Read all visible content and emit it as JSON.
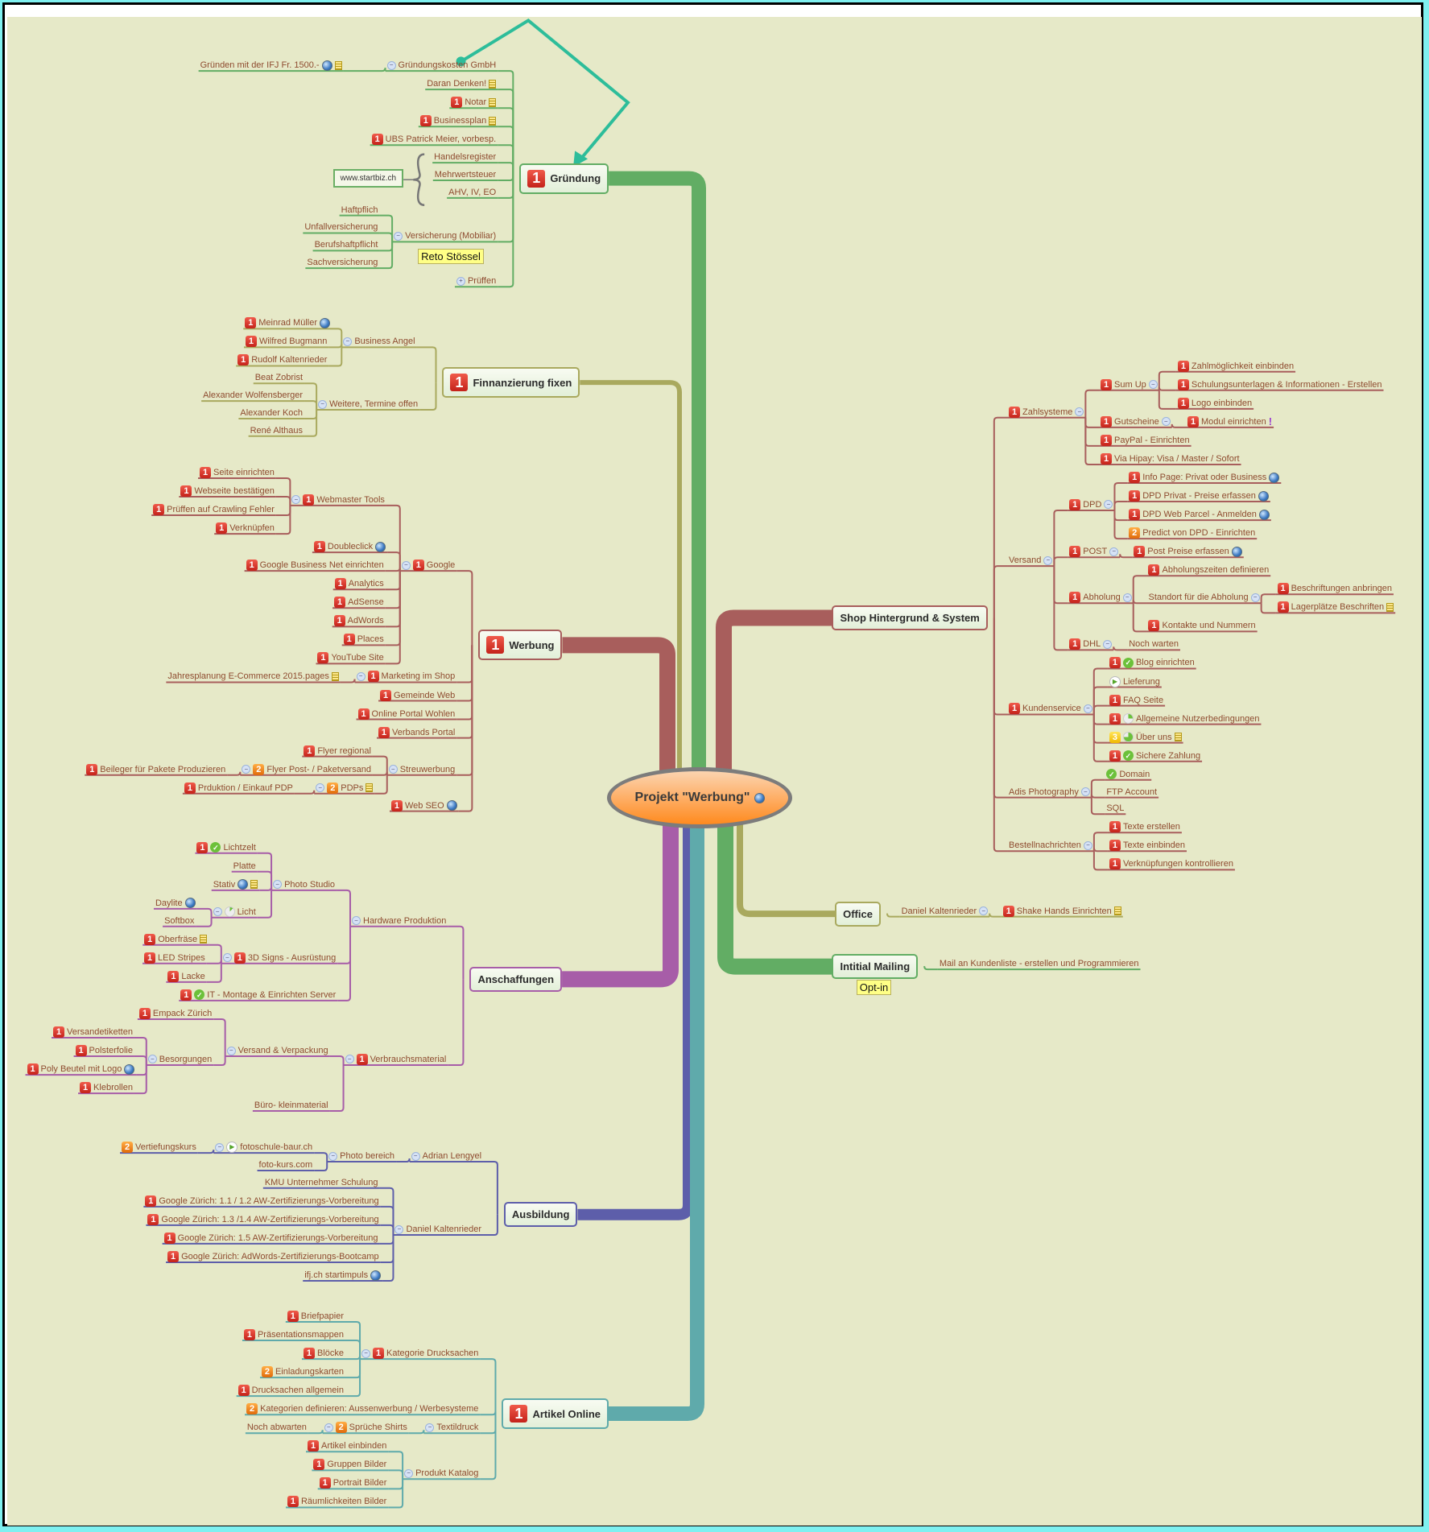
{
  "central": {
    "label": "Projekt \"Werbung\"",
    "icon": "globe-icon"
  },
  "colors": {
    "background": "#e6e9c8",
    "gruendung": "#62ad64",
    "finanzierung": "#a9a95e",
    "werbung": "#a85e5c",
    "shop": "#a85e5c",
    "anschaffungen": "#a75da8",
    "ausbildung": "#5d5eaa",
    "artikel": "#5faaab",
    "office": "#a9a95e",
    "mailing": "#62ad64",
    "relationship": "#2dbd9a"
  },
  "topics": [
    {
      "id": "gruendung",
      "label": "Gründung",
      "priority": 1
    },
    {
      "id": "finanzierung",
      "label": "Finnanzierung fixen",
      "priority": 1
    },
    {
      "id": "werbung",
      "label": "Werbung",
      "priority": 1
    },
    {
      "id": "anschaffungen",
      "label": "Anschaffungen",
      "priority": null
    },
    {
      "id": "ausbildung",
      "label": "Ausbildung",
      "priority": null
    },
    {
      "id": "artikel",
      "label": "Artikel Online",
      "priority": 1
    },
    {
      "id": "shop",
      "label": "Shop Hintergrund & System",
      "priority": null
    },
    {
      "id": "office",
      "label": "Office",
      "priority": null
    },
    {
      "id": "mailing",
      "label": "Intitial Mailing",
      "priority": null
    }
  ],
  "callouts": {
    "gruendung_versicherung": "Reto Stössel",
    "mailing": "Opt-in"
  },
  "boundary": {
    "label": "www.startbiz.ch"
  },
  "nodes": [
    {
      "id": "g1",
      "label": "Gründungskosten GmbH",
      "collapse": true
    },
    {
      "id": "g1a",
      "label": "Gründen mit der IFJ Fr. 1500.-",
      "icons": [
        "globe",
        "note"
      ]
    },
    {
      "id": "g2",
      "label": "Daran Denken!",
      "icons": [
        "note"
      ]
    },
    {
      "id": "g3",
      "label": "Notar",
      "priority": 1,
      "icons": [
        "note"
      ]
    },
    {
      "id": "g4",
      "label": "Businessplan",
      "priority": 1,
      "icons": [
        "note"
      ]
    },
    {
      "id": "g5",
      "label": "UBS Patrick Meier, vorbesp.",
      "priority": 1
    },
    {
      "id": "g6",
      "label": "Handelsregister"
    },
    {
      "id": "g7",
      "label": "Mehrwertsteuer"
    },
    {
      "id": "g8",
      "label": "AHV, IV, EO"
    },
    {
      "id": "g9",
      "label": "Versicherung (Mobiliar)",
      "collapse": true
    },
    {
      "id": "g9a",
      "label": "Haftpflich"
    },
    {
      "id": "g9b",
      "label": "Unfallversicherung"
    },
    {
      "id": "g9c",
      "label": "Berufshaftpflicht"
    },
    {
      "id": "g9d",
      "label": "Sachversicherung"
    },
    {
      "id": "g10",
      "label": "Prüffen",
      "expand": true
    },
    {
      "id": "f1",
      "label": "Business Angel",
      "collapse": true
    },
    {
      "id": "f1a",
      "label": "Meinrad Müller",
      "priority": 1,
      "icons": [
        "globe"
      ]
    },
    {
      "id": "f1b",
      "label": "Wilfred Bugmann",
      "priority": 1
    },
    {
      "id": "f1c",
      "label": "Rudolf Kaltenrieder",
      "priority": 1
    },
    {
      "id": "f2",
      "label": "Weitere, Termine offen",
      "collapse": true
    },
    {
      "id": "f2a",
      "label": "Beat Zobrist"
    },
    {
      "id": "f2b",
      "label": "Alexander Wolfensberger"
    },
    {
      "id": "f2c",
      "label": "Alexander Koch"
    },
    {
      "id": "f2d",
      "label": "René Althaus"
    },
    {
      "id": "w1",
      "label": "Webmaster Tools",
      "priority": 1,
      "collapse": true
    },
    {
      "id": "w1a",
      "label": "Seite einrichten",
      "priority": 1
    },
    {
      "id": "w1b",
      "label": "Webseite bestätigen",
      "priority": 1
    },
    {
      "id": "w1c",
      "label": "Prüffen auf Crawling Fehler",
      "priority": 1
    },
    {
      "id": "w1d",
      "label": "Verknüpfen",
      "priority": 1
    },
    {
      "id": "w2",
      "label": "Google",
      "priority": 1,
      "collapse": true
    },
    {
      "id": "w2a",
      "label": "Doubleclick",
      "priority": 1,
      "icons": [
        "globe"
      ]
    },
    {
      "id": "w2b",
      "label": "Google Business Net einrichten",
      "priority": 1
    },
    {
      "id": "w2c",
      "label": "Analytics",
      "priority": 1
    },
    {
      "id": "w2d",
      "label": "AdSense",
      "priority": 1
    },
    {
      "id": "w2e",
      "label": "AdWords",
      "priority": 1
    },
    {
      "id": "w2f",
      "label": "Places",
      "priority": 1
    },
    {
      "id": "w2g",
      "label": "YouTube Site",
      "priority": 1
    },
    {
      "id": "w3",
      "label": "Marketing im Shop",
      "priority": 1,
      "collapse": true
    },
    {
      "id": "w3a",
      "label": "Jahresplanung E-Commerce 2015.pages",
      "icons": [
        "note"
      ]
    },
    {
      "id": "w4",
      "label": "Gemeinde Web",
      "priority": 1
    },
    {
      "id": "w5",
      "label": "Online Portal Wohlen",
      "priority": 1
    },
    {
      "id": "w6",
      "label": "Verbands Portal",
      "priority": 1
    },
    {
      "id": "w7",
      "label": "Streuwerbung",
      "collapse": true
    },
    {
      "id": "w7a",
      "label": "Flyer regional",
      "priority": 1
    },
    {
      "id": "w7b",
      "label": "Flyer Post- / Paketversand",
      "priority": 2,
      "collapse": true
    },
    {
      "id": "w7b1",
      "label": "Beileger für Pakete Produzieren",
      "priority": 1
    },
    {
      "id": "w7c",
      "label": "PDPs",
      "priority": 2,
      "icons": [
        "note"
      ],
      "collapse": true
    },
    {
      "id": "w7c1",
      "label": "Prduktion / Einkauf PDP",
      "priority": 1
    },
    {
      "id": "w8",
      "label": "Web SEO",
      "priority": 1,
      "icons": [
        "globe"
      ]
    },
    {
      "id": "a1",
      "label": "Hardware Produktion",
      "collapse": true
    },
    {
      "id": "a1a",
      "label": "Photo Studio",
      "collapse": true
    },
    {
      "id": "a1a1",
      "label": "Lichtzelt",
      "priority": 1,
      "task": "done"
    },
    {
      "id": "a1a2",
      "label": "Platte"
    },
    {
      "id": "a1a3",
      "label": "Stativ",
      "icons": [
        "globe",
        "note"
      ]
    },
    {
      "id": "a1a4",
      "label": "Licht",
      "task": "start",
      "collapse": true
    },
    {
      "id": "a1a4a",
      "label": "Daylite",
      "icons": [
        "globe"
      ]
    },
    {
      "id": "a1a4b",
      "label": "Softbox"
    },
    {
      "id": "a1b",
      "label": "3D Signs - Ausrüstung",
      "priority": 1,
      "collapse": true
    },
    {
      "id": "a1b1",
      "label": "Oberfräse",
      "priority": 1,
      "icons": [
        "note"
      ]
    },
    {
      "id": "a1b2",
      "label": "LED  Stripes",
      "priority": 1
    },
    {
      "id": "a1b3",
      "label": "Lacke",
      "priority": 1
    },
    {
      "id": "a1c",
      "label": "IT - Montage & Einrichten Server",
      "priority": 1,
      "task": "done"
    },
    {
      "id": "a2",
      "label": "Verbrauchsmaterial",
      "priority": 1,
      "collapse": true
    },
    {
      "id": "a2a",
      "label": "Versand & Verpackung",
      "collapse": true
    },
    {
      "id": "a2a1",
      "label": "Empack Zürich",
      "priority": 1
    },
    {
      "id": "a2a2",
      "label": "Besorgungen",
      "collapse": true
    },
    {
      "id": "a2a2a",
      "label": "Versandetiketten",
      "priority": 1
    },
    {
      "id": "a2a2b",
      "label": "Polsterfolie",
      "priority": 1
    },
    {
      "id": "a2a2c",
      "label": "Poly Beutel mit Logo",
      "priority": 1,
      "icons": [
        "globe"
      ]
    },
    {
      "id": "a2a2d",
      "label": "Klebrollen",
      "priority": 1
    },
    {
      "id": "a2b",
      "label": "Büro- kleinmaterial"
    },
    {
      "id": "b1",
      "label": "Adrian Lengyel",
      "collapse": true
    },
    {
      "id": "b1a",
      "label": "Photo bereich",
      "collapse": true
    },
    {
      "id": "b1a1",
      "label": "fotoschule-baur.ch",
      "task": "play",
      "collapse": true
    },
    {
      "id": "b1a1a",
      "label": "Vertiefungskurs",
      "priority": 2
    },
    {
      "id": "b1a2",
      "label": "foto-kurs.com"
    },
    {
      "id": "b2",
      "label": "Daniel Kaltenrieder",
      "collapse": true
    },
    {
      "id": "b2a",
      "label": "KMU Unternehmer Schulung"
    },
    {
      "id": "b2b",
      "label": "Google Zürich: 1.1 / 1.2 AW-Zertifizierungs-Vorbereitung",
      "priority": 1
    },
    {
      "id": "b2c",
      "label": "Google Zürich: 1.3 /1.4 AW-Zertifizierungs-Vorbereitung",
      "priority": 1
    },
    {
      "id": "b2d",
      "label": "Google Zürich: 1.5 AW-Zertifizierungs-Vorbereitung",
      "priority": 1
    },
    {
      "id": "b2e",
      "label": "Google Zürich: AdWords-Zertifizierungs-Bootcamp",
      "priority": 1
    },
    {
      "id": "b2f",
      "label": "ifj.ch startimpuls",
      "icons": [
        "globe"
      ]
    },
    {
      "id": "o1",
      "label": "Kategorie Drucksachen",
      "priority": 1,
      "collapse": true
    },
    {
      "id": "o1a",
      "label": "Briefpapier",
      "priority": 1
    },
    {
      "id": "o1b",
      "label": "Präsentationsmappen",
      "priority": 1
    },
    {
      "id": "o1c",
      "label": "Blöcke",
      "priority": 1
    },
    {
      "id": "o1d",
      "label": "Einladungskarten",
      "priority": 2
    },
    {
      "id": "o1e",
      "label": "Drucksachen allgemein",
      "priority": 1
    },
    {
      "id": "o2",
      "label": "Kategorien definieren: Aussenwerbung / Werbesysteme",
      "priority": 2
    },
    {
      "id": "o3",
      "label": "Textildruck",
      "collapse": true
    },
    {
      "id": "o3a",
      "label": "Sprüche Shirts",
      "priority": 2,
      "collapse": true
    },
    {
      "id": "o3a1",
      "label": "Noch abwarten"
    },
    {
      "id": "o4",
      "label": "Produkt Katalog",
      "collapse": true
    },
    {
      "id": "o4a",
      "label": "Artikel einbinden",
      "priority": 1
    },
    {
      "id": "o4b",
      "label": "Gruppen Bilder",
      "priority": 1
    },
    {
      "id": "o4c",
      "label": "Portrait Bilder",
      "priority": 1
    },
    {
      "id": "o4d",
      "label": "Räumlichkeiten Bilder",
      "priority": 1
    },
    {
      "id": "s1",
      "label": "Zahlsysteme",
      "priority": 1,
      "collapse": true
    },
    {
      "id": "s1a",
      "label": "Sum Up",
      "priority": 1,
      "collapse": true
    },
    {
      "id": "s1a1",
      "label": "Zahlmöglichkeit einbinden",
      "priority": 1
    },
    {
      "id": "s1a2",
      "label": "Schulungsunterlagen & Informationen - Erstellen",
      "priority": 1
    },
    {
      "id": "s1a3",
      "label": "Logo einbinden",
      "priority": 1
    },
    {
      "id": "s1b",
      "label": "Gutscheine",
      "priority": 1,
      "collapse": true
    },
    {
      "id": "s1b1",
      "label": "Modul einrichten",
      "priority": 1,
      "icons": [
        "excl"
      ]
    },
    {
      "id": "s1c",
      "label": "PayPal - Einrichten",
      "priority": 1
    },
    {
      "id": "s1d",
      "label": "Via Hipay: Visa / Master / Sofort",
      "priority": 1
    },
    {
      "id": "s2",
      "label": "Versand",
      "collapse": true
    },
    {
      "id": "s2a",
      "label": "DPD",
      "priority": 1,
      "collapse": true
    },
    {
      "id": "s2a1",
      "label": "Info Page: Privat oder Business",
      "priority": 1,
      "icons": [
        "globe"
      ]
    },
    {
      "id": "s2a2",
      "label": "DPD Privat - Preise erfassen",
      "priority": 1,
      "icons": [
        "globe"
      ]
    },
    {
      "id": "s2a3",
      "label": "DPD Web Parcel - Anmelden",
      "priority": 1,
      "icons": [
        "globe"
      ]
    },
    {
      "id": "s2a4",
      "label": "Predict von DPD - Einrichten",
      "priority": 2
    },
    {
      "id": "s2b",
      "label": "POST",
      "priority": 1,
      "collapse": true
    },
    {
      "id": "s2b1",
      "label": "Post Preise erfassen",
      "priority": 1,
      "icons": [
        "globe"
      ]
    },
    {
      "id": "s2c",
      "label": "Abholung",
      "priority": 1,
      "collapse": true
    },
    {
      "id": "s2c1",
      "label": "Abholungszeiten definieren",
      "priority": 1
    },
    {
      "id": "s2c2",
      "label": "Standort für die Abholung",
      "collapse": true
    },
    {
      "id": "s2c2a",
      "label": "Beschriftungen anbringen",
      "priority": 1
    },
    {
      "id": "s2c2b",
      "label": "Lagerplätze Beschriften",
      "priority": 1,
      "icons": [
        "note"
      ]
    },
    {
      "id": "s2c3",
      "label": "Kontakte und Nummern",
      "priority": 1
    },
    {
      "id": "s2d",
      "label": "DHL",
      "priority": 1,
      "collapse": true
    },
    {
      "id": "s2d1",
      "label": "Noch warten"
    },
    {
      "id": "s3",
      "label": "Kundenservice",
      "priority": 1,
      "collapse": true
    },
    {
      "id": "s3a",
      "label": "Blog einrichten",
      "priority": 1,
      "task": "done"
    },
    {
      "id": "s3b",
      "label": "Lieferung",
      "task": "play"
    },
    {
      "id": "s3c",
      "label": "FAQ Seite",
      "priority": 1
    },
    {
      "id": "s3d",
      "label": "Allgemeine Nutzerbedingungen",
      "priority": 1,
      "task": "25"
    },
    {
      "id": "s3e",
      "label": "Über uns",
      "priority": 3,
      "task": "75",
      "icons": [
        "note"
      ]
    },
    {
      "id": "s3f",
      "label": "Sichere Zahlung",
      "priority": 1,
      "task": "done"
    },
    {
      "id": "s4",
      "label": "Adis Photography",
      "collapse": true
    },
    {
      "id": "s4a",
      "label": "Domain",
      "task": "done"
    },
    {
      "id": "s4b",
      "label": "FTP Account"
    },
    {
      "id": "s4c",
      "label": "SQL"
    },
    {
      "id": "s5",
      "label": "Bestellnachrichten",
      "collapse": true
    },
    {
      "id": "s5a",
      "label": "Texte erstellen",
      "priority": 1
    },
    {
      "id": "s5b",
      "label": "Texte einbinden",
      "priority": 1
    },
    {
      "id": "s5c",
      "label": "Verknüpfungen kontrollieren",
      "priority": 1
    },
    {
      "id": "of1",
      "label": "Daniel Kaltenrieder",
      "collapse": true
    },
    {
      "id": "of1a",
      "label": "Shake Hands Einrichten",
      "priority": 1,
      "icons": [
        "note"
      ]
    },
    {
      "id": "m1",
      "label": "Mail an Kundenliste - erstellen und Programmieren"
    }
  ]
}
